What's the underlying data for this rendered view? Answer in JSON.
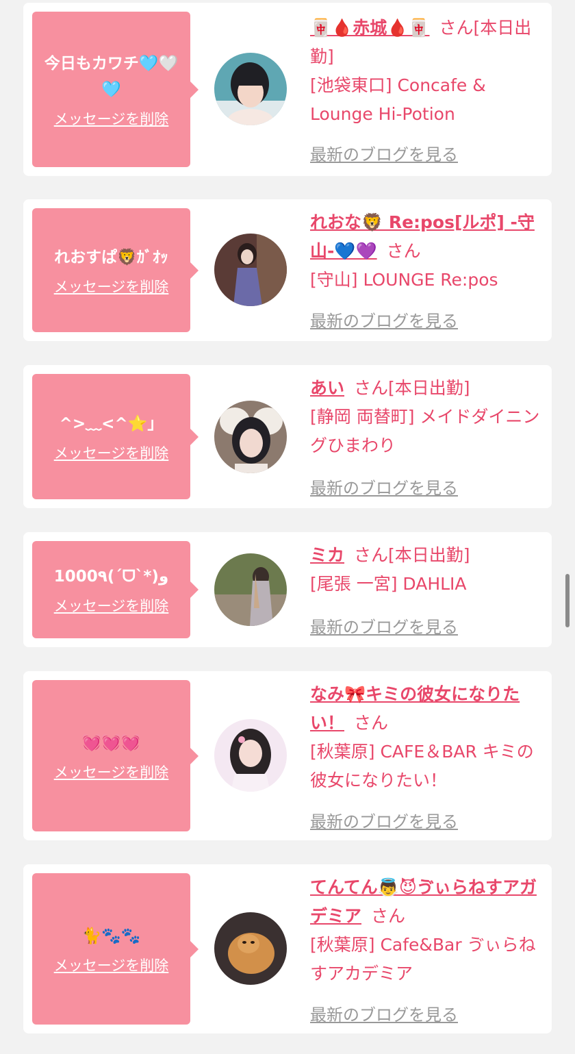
{
  "delete_label": "メッセージを削除",
  "blog_label": "最新のブログを見る",
  "san_label": "さん",
  "cards": [
    {
      "message": "今日もカワチ🩵🤍🩵",
      "name": "🀄🩸赤城🩸🀄",
      "status": "[本日出勤]",
      "shop": "[池袋東口] Concafe & Lounge Hi-Potion"
    },
    {
      "message": "れおすぱ🦁ｶﾞｵｯ",
      "name": "れおな🦁 Re:pos[ルポ] -守山-💙💜",
      "status": "",
      "shop": "[守山] LOUNGE Re:pos"
    },
    {
      "message": "^>﹏<^⭐️」",
      "name": "あい",
      "status": "[本日出勤]",
      "shop": "[静岡 両替町] メイドダイニングひまわり"
    },
    {
      "message": "1000٩(´ᗜ`*)و",
      "name": "ミカ",
      "status": "[本日出勤]",
      "shop": "[尾張 一宮] DAHLIA"
    },
    {
      "message": "💓💓💓",
      "name": "なみ🎀キミの彼女になりたい！",
      "status": "",
      "shop": "[秋葉原] CAFE＆BAR キミの彼女になりたい！"
    },
    {
      "message": "🐈🐾🐾",
      "name": "てんてん👼😈ゔぃらねすアガデミア",
      "status": "",
      "shop": "[秋葉原] Cafe&Bar ゔぃらねすアカデミア"
    }
  ],
  "colors": {
    "accent": "#e8476a",
    "bubble": "#f7909f",
    "background": "#f2f2f2",
    "link_gray": "#999999"
  }
}
